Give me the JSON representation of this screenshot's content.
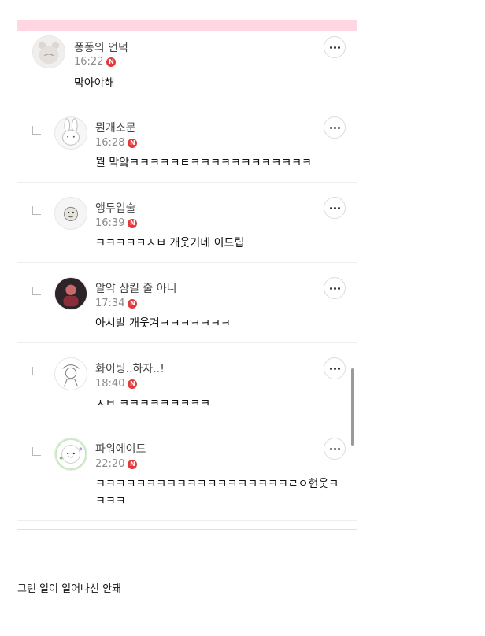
{
  "comments": [
    {
      "nickname": "퐁퐁의 언덕",
      "time": "16:22",
      "badge": "N",
      "text": "막아야해",
      "reply": false
    },
    {
      "nickname": "뭔개소문",
      "time": "16:28",
      "badge": "N",
      "text": "뭘 막앜ㅋㅋㅋㅋㅋㅌㅋㅋㅋㅋㅋㅋㅋㅋㅋㅋㅋㅋ",
      "reply": true
    },
    {
      "nickname": "앵두입술",
      "time": "16:39",
      "badge": "N",
      "text": "ㅋㅋㅋㅋㅋㅅㅂ 개웃기네 이드립",
      "reply": true
    },
    {
      "nickname": "알약 삼킬 줄 아니",
      "time": "17:34",
      "badge": "N",
      "text": "아시발 개웃겨ㅋㅋㅋㅋㅋㅋㅋ",
      "reply": true
    },
    {
      "nickname": "화이팅..하자..!",
      "time": "18:40",
      "badge": "N",
      "text": "ㅅㅂ ㅋㅋㅋㅋㅋㅋㅋㅋㅋ",
      "reply": true
    },
    {
      "nickname": "파워에이드",
      "time": "22:20",
      "badge": "N",
      "text_line1": "ㅋㅋㅋㅋㅋㅋㅋㅋㅋㅋㅋㅋㅋㅋㅋㅋㅋㅋㅋㄹㅇ현웃ㅋ",
      "text_line2": "ㅋㅋㅋ",
      "reply": true
    }
  ],
  "footer": {
    "text": "그런 일이 일어나선 안돼"
  },
  "colors": {
    "accent_strip": "#ffd6e2",
    "new_badge": "#e5383b"
  },
  "icons": {
    "more": "more-dots-icon",
    "reply": "reply-arrow-icon",
    "new": "new-badge-icon"
  }
}
